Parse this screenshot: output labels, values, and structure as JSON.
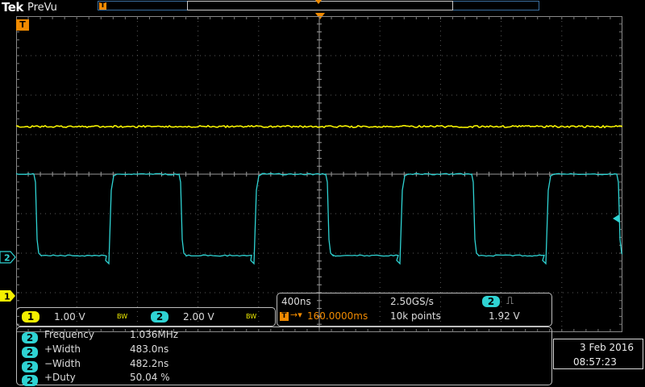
{
  "header": {
    "brand": "Tek",
    "mode": "PreVu"
  },
  "markers": {
    "trigger_icon": "T",
    "ch2_marker": "2",
    "ch1_marker": "1"
  },
  "channels": [
    {
      "number": "1",
      "scale": "1.00 V",
      "bw": "BW",
      "color": "#f3f000"
    },
    {
      "number": "2",
      "scale": "2.00 V",
      "bw": "BW",
      "color": "#2fd3d3"
    }
  ],
  "acquisition": {
    "horizontal_scale": "400ns",
    "sample_rate": "2.50GS/s",
    "trigger_source": "2",
    "trigger_slope_icon": "rising-edge-icon",
    "trigger_slope_glyph": "⎍",
    "trigger_position": "160.0000ms",
    "record_length": "10k points",
    "trigger_level": "1.92 V"
  },
  "measurements": [
    {
      "source": "2",
      "label": "Frequency",
      "value": "1.036MHz"
    },
    {
      "source": "2",
      "label": "+Width",
      "value": "483.0ns"
    },
    {
      "source": "2",
      "label": "−Width",
      "value": "482.2ns"
    },
    {
      "source": "2",
      "label": "+Duty",
      "value": "50.04 %"
    }
  ],
  "datetime": {
    "date": "3 Feb  2016",
    "time": "08:57:23"
  },
  "colors": {
    "ch1": "#f3f000",
    "ch2": "#2fd3d3",
    "trigger": "#f08a00",
    "accent_frame": "#3a6e9e"
  }
}
